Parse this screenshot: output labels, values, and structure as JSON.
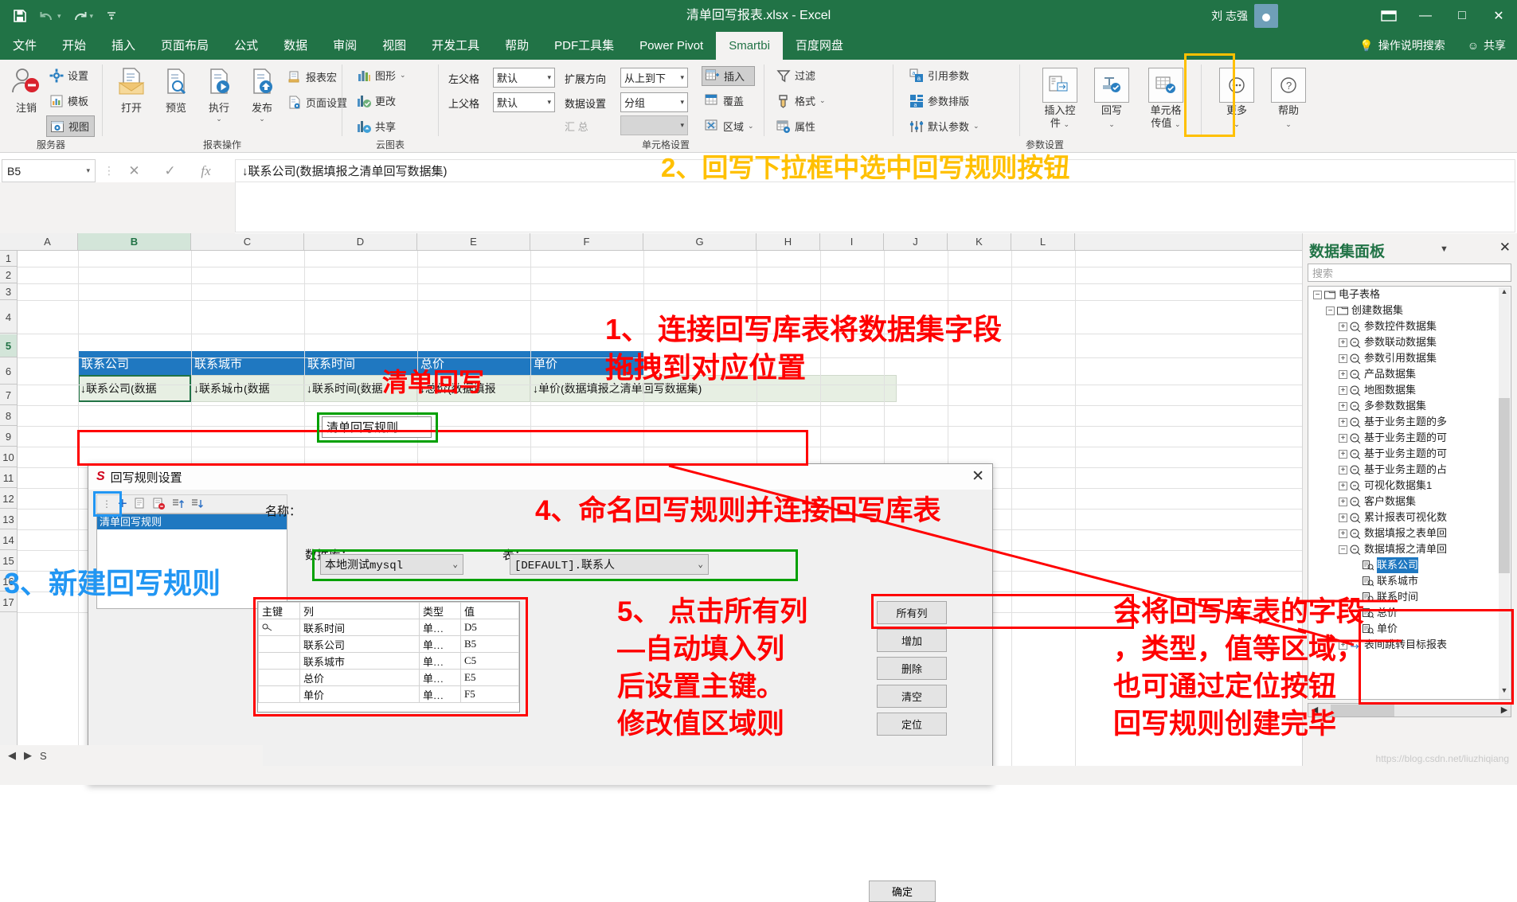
{
  "titlebar": {
    "filename": "清单回写报表.xlsx  -  Excel",
    "user_name": "刘 志强",
    "save_icon": "save-icon",
    "undo_icon": "undo-icon",
    "redo_icon": "redo-icon",
    "customize_icon": "customize-quick-access-icon",
    "minimize": "—",
    "maximize": "□",
    "close": "✕",
    "ribbon_display": "ribbon-display-options-icon"
  },
  "tabs": {
    "items": [
      {
        "label": "文件",
        "active": false
      },
      {
        "label": "开始",
        "active": false
      },
      {
        "label": "插入",
        "active": false
      },
      {
        "label": "页面布局",
        "active": false
      },
      {
        "label": "公式",
        "active": false
      },
      {
        "label": "数据",
        "active": false
      },
      {
        "label": "审阅",
        "active": false
      },
      {
        "label": "视图",
        "active": false
      },
      {
        "label": "开发工具",
        "active": false
      },
      {
        "label": "帮助",
        "active": false
      },
      {
        "label": "PDF工具集",
        "active": false
      },
      {
        "label": "Power Pivot",
        "active": false
      },
      {
        "label": "Smartbi",
        "active": true
      },
      {
        "label": "百度网盘",
        "active": false
      }
    ],
    "tell_me": "操作说明搜索",
    "share": "共享"
  },
  "ribbon": {
    "groups": [
      {
        "caption": "服务器"
      },
      {
        "caption": "报表操作"
      },
      {
        "caption": "云图表"
      },
      {
        "caption": "单元格设置"
      },
      {
        "caption": "参数设置"
      }
    ],
    "server": {
      "logout": "注销",
      "settings": "设置",
      "template": "模板",
      "view": "视图"
    },
    "report_ops": {
      "open": "打开",
      "preview": "预览",
      "execute": "执行",
      "publish": "发布",
      "macro": "报表宏",
      "page_setup": "页面设置"
    },
    "cloud_chart": {
      "graph": "图形",
      "change": "更改",
      "share": "共享"
    },
    "cell_settings": {
      "left_parent_label": "左父格",
      "left_parent_value": "默认",
      "top_parent_label": "上父格",
      "top_parent_value": "默认",
      "expand_dir_label": "扩展方向",
      "expand_dir_value": "从上到下",
      "data_set_label": "数据设置",
      "data_set_value": "分组",
      "summary_label": "汇      总",
      "summary_value": "",
      "insert": "插入",
      "overlay": "覆盖",
      "area": "区域",
      "filter": "过滤",
      "format": "格式",
      "property": "属性"
    },
    "param_settings": {
      "ref_param": "引用参数",
      "param_layout": "参数排版",
      "default_param": "默认参数",
      "insert_control": "插入控\n件",
      "writeback": "回写",
      "cell_pass": "单元格\n传值",
      "more": "更多",
      "help": "帮助"
    }
  },
  "formula_bar": {
    "name_box": "B5",
    "cancel_icon": "cancel-icon",
    "confirm_icon": "confirm-icon",
    "fx_icon": "insert-function-icon",
    "formula": "↓联系公司(数据填报之清单回写数据集)"
  },
  "sheet": {
    "columns": [
      "A",
      "B",
      "C",
      "D",
      "E",
      "F",
      "G",
      "H",
      "I",
      "J",
      "K",
      "L"
    ],
    "rows": [
      "1",
      "2",
      "3",
      "4",
      "5",
      "6",
      "7",
      "8",
      "9",
      "10",
      "11",
      "12",
      "13",
      "14",
      "15",
      "16",
      "17"
    ],
    "title_cell": "清单回写",
    "header_row": [
      "联系公司",
      "联系城市",
      "联系时间",
      "总价",
      "单价"
    ],
    "data_row": [
      "↓联系公司(数据",
      "↓联系城市(数据",
      "↓联系时间(数据",
      "↓总价(数据填报",
      "↓单价(数据填报之清单回写数据集)"
    ],
    "sheet_tab": "S"
  },
  "dataset_panel": {
    "title": "数据集面板",
    "caret_icon": "chevron-down-icon",
    "close_icon": "close-icon",
    "search_placeholder": "搜索",
    "tree": [
      {
        "label": "电子表格",
        "depth": 0,
        "type": "folder",
        "toggle": "−"
      },
      {
        "label": "创建数据集",
        "depth": 1,
        "type": "folder",
        "toggle": "−"
      },
      {
        "label": "参数控件数据集",
        "depth": 2,
        "type": "dataset",
        "toggle": "+"
      },
      {
        "label": "参数联动数据集",
        "depth": 2,
        "type": "dataset",
        "toggle": "+"
      },
      {
        "label": "参数引用数据集",
        "depth": 2,
        "type": "dataset",
        "toggle": "+"
      },
      {
        "label": "产品数据集",
        "depth": 2,
        "type": "dataset",
        "toggle": "+"
      },
      {
        "label": "地图数据集",
        "depth": 2,
        "type": "dataset",
        "toggle": "+"
      },
      {
        "label": "多参数数据集",
        "depth": 2,
        "type": "dataset",
        "toggle": "+"
      },
      {
        "label": "基于业务主题的多",
        "depth": 2,
        "type": "dataset",
        "toggle": "+"
      },
      {
        "label": "基于业务主题的可",
        "depth": 2,
        "type": "dataset",
        "toggle": "+"
      },
      {
        "label": "基于业务主题的可",
        "depth": 2,
        "type": "dataset",
        "toggle": "+"
      },
      {
        "label": "基于业务主题的占",
        "depth": 2,
        "type": "dataset",
        "toggle": "+"
      },
      {
        "label": "可视化数据集1",
        "depth": 2,
        "type": "dataset",
        "toggle": "+"
      },
      {
        "label": "客户数据集",
        "depth": 2,
        "type": "dataset",
        "toggle": "+"
      },
      {
        "label": "累计报表可视化数",
        "depth": 2,
        "type": "dataset",
        "toggle": "+"
      },
      {
        "label": "数据填报之表单回",
        "depth": 2,
        "type": "dataset",
        "toggle": "+"
      },
      {
        "label": "数据填报之清单回",
        "depth": 2,
        "type": "dataset",
        "toggle": "−"
      },
      {
        "label": "联系公司",
        "depth": 3,
        "type": "field",
        "toggle": "",
        "selected": true
      },
      {
        "label": "联系城市",
        "depth": 3,
        "type": "field",
        "toggle": ""
      },
      {
        "label": "联系时间",
        "depth": 3,
        "type": "field",
        "toggle": ""
      },
      {
        "label": "总价",
        "depth": 3,
        "type": "field",
        "toggle": ""
      },
      {
        "label": "单价",
        "depth": 3,
        "type": "field",
        "toggle": ""
      },
      {
        "label": "表间跳转目标报表",
        "depth": 2,
        "type": "jump",
        "toggle": "+"
      }
    ]
  },
  "dialog": {
    "title": "回写规则设置",
    "logo": "S",
    "close_icon": "close-icon",
    "toolbar_icons": [
      "add-icon",
      "copy-icon",
      "delete-icon",
      "move-up-icon",
      "move-down-icon"
    ],
    "rule_list": [
      "清单回写规则"
    ],
    "name_label": "名称：",
    "name_value": "清单回写规则",
    "ok_button": "确定",
    "db_label": "数据库：",
    "db_value": "本地测试mysql",
    "table_label": "表：",
    "table_value": "[DEFAULT].联系人",
    "columns_header": [
      "主键",
      "列",
      "类型",
      "值"
    ],
    "columns_rows": [
      {
        "key": "key-icon",
        "col": "联系时间",
        "type": "单…",
        "value": "D5"
      },
      {
        "key": "",
        "col": "联系公司",
        "type": "单…",
        "value": "B5"
      },
      {
        "key": "",
        "col": "联系城市",
        "type": "单…",
        "value": "C5"
      },
      {
        "key": "",
        "col": "总价",
        "type": "单…",
        "value": "E5"
      },
      {
        "key": "",
        "col": "单价",
        "type": "单…",
        "value": "F5"
      }
    ],
    "side_buttons": [
      "所有列",
      "增加",
      "删除",
      "清空",
      "定位"
    ]
  },
  "annotations": [
    {
      "id": "a2",
      "text": "2、回写下拉框中选中回写规则按钮",
      "color": "#ffc000"
    },
    {
      "id": "a1",
      "text": "1、 连接回写库表将数据集字段\n拖拽到对应位置",
      "color": "#ff0000"
    },
    {
      "id": "a3",
      "text": "3、新建回写规则",
      "color": "#2196f3"
    },
    {
      "id": "a4",
      "text": "4、命名回写规则并连接回写库表",
      "color": "#ff0000"
    },
    {
      "id": "a5",
      "text": "5、 点击所有列\n—自动填入列\n后设置主键。\n修改值区域则",
      "color": "#ff0000"
    },
    {
      "id": "a6",
      "text": "会将回写库表的字段\n，类型，值等区域，\n也可通过定位按钮\n回写规则创建完毕",
      "color": "#ff0000"
    }
  ],
  "watermark": "https://blog.csdn.net/liuzhiqiang"
}
